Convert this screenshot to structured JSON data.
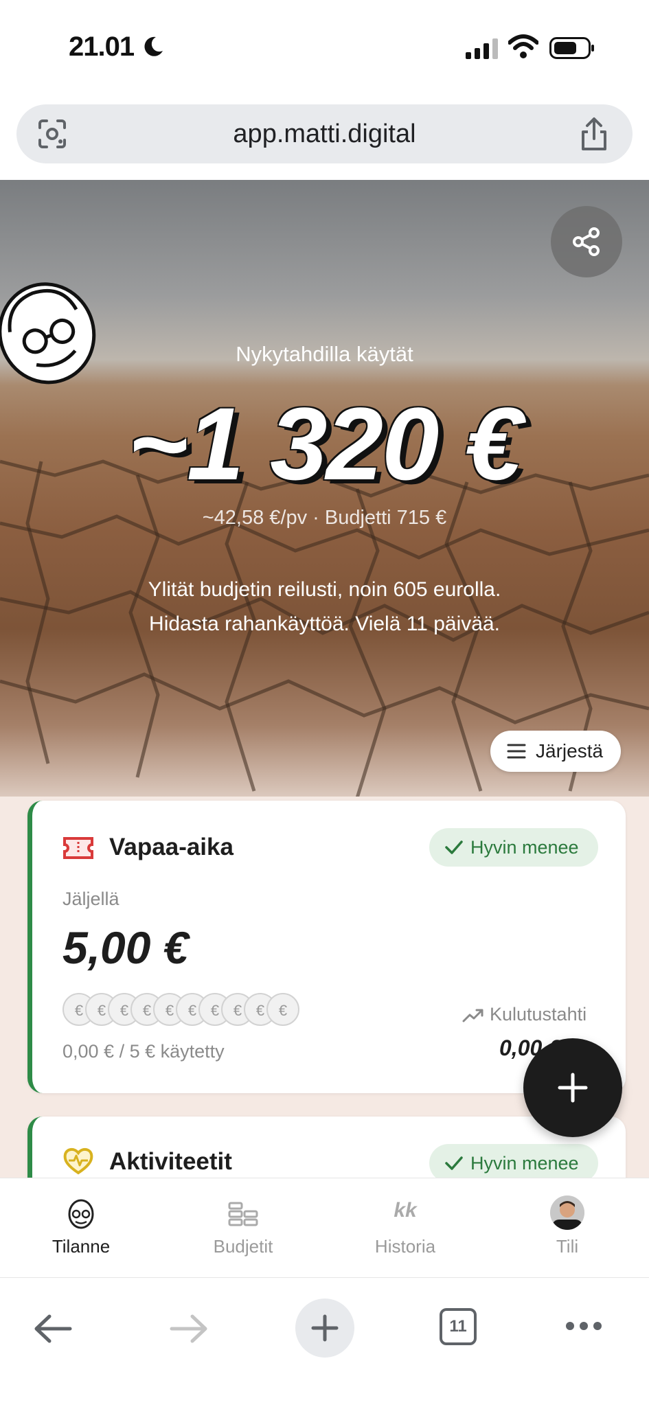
{
  "status_bar": {
    "time": "21.01"
  },
  "browser": {
    "url": "app.matti.digital",
    "tab_count": "11"
  },
  "hero": {
    "subtitle": "Nykytahdilla käytät",
    "amount": "~1 320 €",
    "rate": "~42,58 €/pv · Budjetti 715 €",
    "message_line1": "Ylität budjetin reilusti, noin 605 eurolla.",
    "message_line2": "Hidasta rahankäyttöä. Vielä 11 päivää.",
    "sort_label": "Järjestä"
  },
  "cards": [
    {
      "title": "Vapaa-aika",
      "icon": "ticket-icon",
      "badge": "Hyvin menee",
      "remaining_label": "Jäljellä",
      "remaining_value": "5,00 €",
      "coins": [
        "€",
        "€",
        "€",
        "€",
        "€",
        "€",
        "€",
        "€",
        "€",
        "€"
      ],
      "spent": "0,00 € / 5 € käytetty",
      "pace_label": "Kulutustahti",
      "pace_value": "0,00 €",
      "accent": "#2e8b47"
    },
    {
      "title": "Aktiviteetit",
      "icon": "heart-pulse-icon",
      "badge": "Hyvin menee",
      "accent": "#2e8b47"
    }
  ],
  "bottom_nav": [
    {
      "label": "Tilanne",
      "icon": "avatar-face-icon",
      "active": true
    },
    {
      "label": "Budjetit",
      "icon": "budgets-icon",
      "active": false
    },
    {
      "label": "Historia",
      "icon": "kk-icon",
      "icon_text": "kk",
      "active": false
    },
    {
      "label": "Tili",
      "icon": "profile-photo",
      "active": false
    }
  ]
}
